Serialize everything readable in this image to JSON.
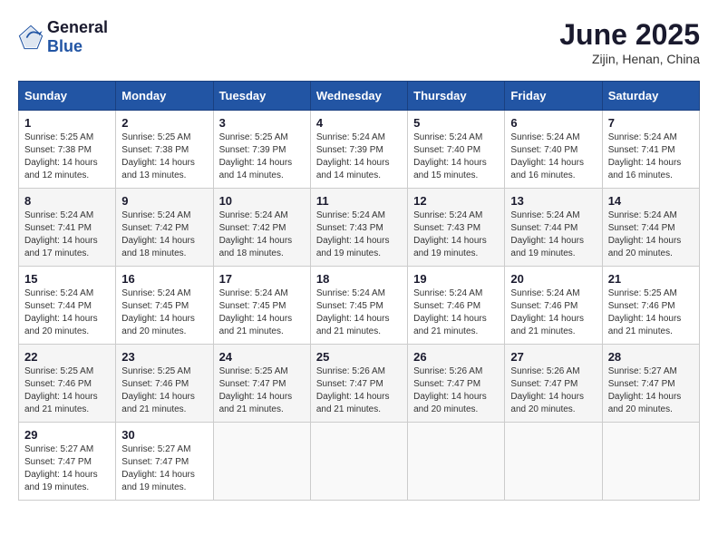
{
  "header": {
    "logo_general": "General",
    "logo_blue": "Blue",
    "month_title": "June 2025",
    "subtitle": "Zijin, Henan, China"
  },
  "weekdays": [
    "Sunday",
    "Monday",
    "Tuesday",
    "Wednesday",
    "Thursday",
    "Friday",
    "Saturday"
  ],
  "weeks": [
    [
      {
        "day": "1",
        "sunrise": "Sunrise: 5:25 AM",
        "sunset": "Sunset: 7:38 PM",
        "daylight": "Daylight: 14 hours and 12 minutes."
      },
      {
        "day": "2",
        "sunrise": "Sunrise: 5:25 AM",
        "sunset": "Sunset: 7:38 PM",
        "daylight": "Daylight: 14 hours and 13 minutes."
      },
      {
        "day": "3",
        "sunrise": "Sunrise: 5:25 AM",
        "sunset": "Sunset: 7:39 PM",
        "daylight": "Daylight: 14 hours and 14 minutes."
      },
      {
        "day": "4",
        "sunrise": "Sunrise: 5:24 AM",
        "sunset": "Sunset: 7:39 PM",
        "daylight": "Daylight: 14 hours and 14 minutes."
      },
      {
        "day": "5",
        "sunrise": "Sunrise: 5:24 AM",
        "sunset": "Sunset: 7:40 PM",
        "daylight": "Daylight: 14 hours and 15 minutes."
      },
      {
        "day": "6",
        "sunrise": "Sunrise: 5:24 AM",
        "sunset": "Sunset: 7:40 PM",
        "daylight": "Daylight: 14 hours and 16 minutes."
      },
      {
        "day": "7",
        "sunrise": "Sunrise: 5:24 AM",
        "sunset": "Sunset: 7:41 PM",
        "daylight": "Daylight: 14 hours and 16 minutes."
      }
    ],
    [
      {
        "day": "8",
        "sunrise": "Sunrise: 5:24 AM",
        "sunset": "Sunset: 7:41 PM",
        "daylight": "Daylight: 14 hours and 17 minutes."
      },
      {
        "day": "9",
        "sunrise": "Sunrise: 5:24 AM",
        "sunset": "Sunset: 7:42 PM",
        "daylight": "Daylight: 14 hours and 18 minutes."
      },
      {
        "day": "10",
        "sunrise": "Sunrise: 5:24 AM",
        "sunset": "Sunset: 7:42 PM",
        "daylight": "Daylight: 14 hours and 18 minutes."
      },
      {
        "day": "11",
        "sunrise": "Sunrise: 5:24 AM",
        "sunset": "Sunset: 7:43 PM",
        "daylight": "Daylight: 14 hours and 19 minutes."
      },
      {
        "day": "12",
        "sunrise": "Sunrise: 5:24 AM",
        "sunset": "Sunset: 7:43 PM",
        "daylight": "Daylight: 14 hours and 19 minutes."
      },
      {
        "day": "13",
        "sunrise": "Sunrise: 5:24 AM",
        "sunset": "Sunset: 7:44 PM",
        "daylight": "Daylight: 14 hours and 19 minutes."
      },
      {
        "day": "14",
        "sunrise": "Sunrise: 5:24 AM",
        "sunset": "Sunset: 7:44 PM",
        "daylight": "Daylight: 14 hours and 20 minutes."
      }
    ],
    [
      {
        "day": "15",
        "sunrise": "Sunrise: 5:24 AM",
        "sunset": "Sunset: 7:44 PM",
        "daylight": "Daylight: 14 hours and 20 minutes."
      },
      {
        "day": "16",
        "sunrise": "Sunrise: 5:24 AM",
        "sunset": "Sunset: 7:45 PM",
        "daylight": "Daylight: 14 hours and 20 minutes."
      },
      {
        "day": "17",
        "sunrise": "Sunrise: 5:24 AM",
        "sunset": "Sunset: 7:45 PM",
        "daylight": "Daylight: 14 hours and 21 minutes."
      },
      {
        "day": "18",
        "sunrise": "Sunrise: 5:24 AM",
        "sunset": "Sunset: 7:45 PM",
        "daylight": "Daylight: 14 hours and 21 minutes."
      },
      {
        "day": "19",
        "sunrise": "Sunrise: 5:24 AM",
        "sunset": "Sunset: 7:46 PM",
        "daylight": "Daylight: 14 hours and 21 minutes."
      },
      {
        "day": "20",
        "sunrise": "Sunrise: 5:24 AM",
        "sunset": "Sunset: 7:46 PM",
        "daylight": "Daylight: 14 hours and 21 minutes."
      },
      {
        "day": "21",
        "sunrise": "Sunrise: 5:25 AM",
        "sunset": "Sunset: 7:46 PM",
        "daylight": "Daylight: 14 hours and 21 minutes."
      }
    ],
    [
      {
        "day": "22",
        "sunrise": "Sunrise: 5:25 AM",
        "sunset": "Sunset: 7:46 PM",
        "daylight": "Daylight: 14 hours and 21 minutes."
      },
      {
        "day": "23",
        "sunrise": "Sunrise: 5:25 AM",
        "sunset": "Sunset: 7:46 PM",
        "daylight": "Daylight: 14 hours and 21 minutes."
      },
      {
        "day": "24",
        "sunrise": "Sunrise: 5:25 AM",
        "sunset": "Sunset: 7:47 PM",
        "daylight": "Daylight: 14 hours and 21 minutes."
      },
      {
        "day": "25",
        "sunrise": "Sunrise: 5:26 AM",
        "sunset": "Sunset: 7:47 PM",
        "daylight": "Daylight: 14 hours and 21 minutes."
      },
      {
        "day": "26",
        "sunrise": "Sunrise: 5:26 AM",
        "sunset": "Sunset: 7:47 PM",
        "daylight": "Daylight: 14 hours and 20 minutes."
      },
      {
        "day": "27",
        "sunrise": "Sunrise: 5:26 AM",
        "sunset": "Sunset: 7:47 PM",
        "daylight": "Daylight: 14 hours and 20 minutes."
      },
      {
        "day": "28",
        "sunrise": "Sunrise: 5:27 AM",
        "sunset": "Sunset: 7:47 PM",
        "daylight": "Daylight: 14 hours and 20 minutes."
      }
    ],
    [
      {
        "day": "29",
        "sunrise": "Sunrise: 5:27 AM",
        "sunset": "Sunset: 7:47 PM",
        "daylight": "Daylight: 14 hours and 19 minutes."
      },
      {
        "day": "30",
        "sunrise": "Sunrise: 5:27 AM",
        "sunset": "Sunset: 7:47 PM",
        "daylight": "Daylight: 14 hours and 19 minutes."
      },
      null,
      null,
      null,
      null,
      null
    ]
  ]
}
